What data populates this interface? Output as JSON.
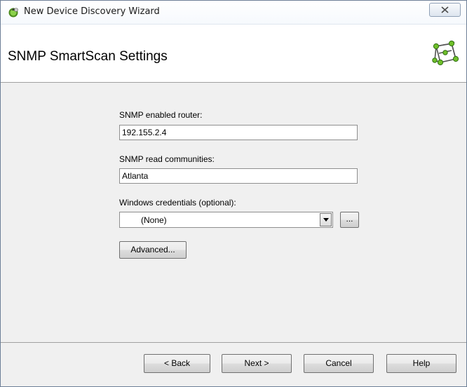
{
  "window": {
    "title": "New Device Discovery Wizard",
    "close_glyph": "☒"
  },
  "header": {
    "title": "SNMP SmartScan Settings",
    "icon": "network-cube-icon"
  },
  "form": {
    "router_label": "SNMP enabled router:",
    "router_value": "192.155.2.4",
    "communities_label": "SNMP read communities:",
    "communities_value": "Atlanta",
    "credentials_label": "Windows credentials (optional):",
    "credentials_value": "(None)",
    "browse_label": "...",
    "advanced_label": "Advanced..."
  },
  "footer": {
    "back_label": "< Back",
    "next_label": "Next >",
    "cancel_label": "Cancel",
    "help_label": "Help"
  },
  "colors": {
    "accent": "#6fbf2a",
    "frame": "#6d7f97"
  }
}
